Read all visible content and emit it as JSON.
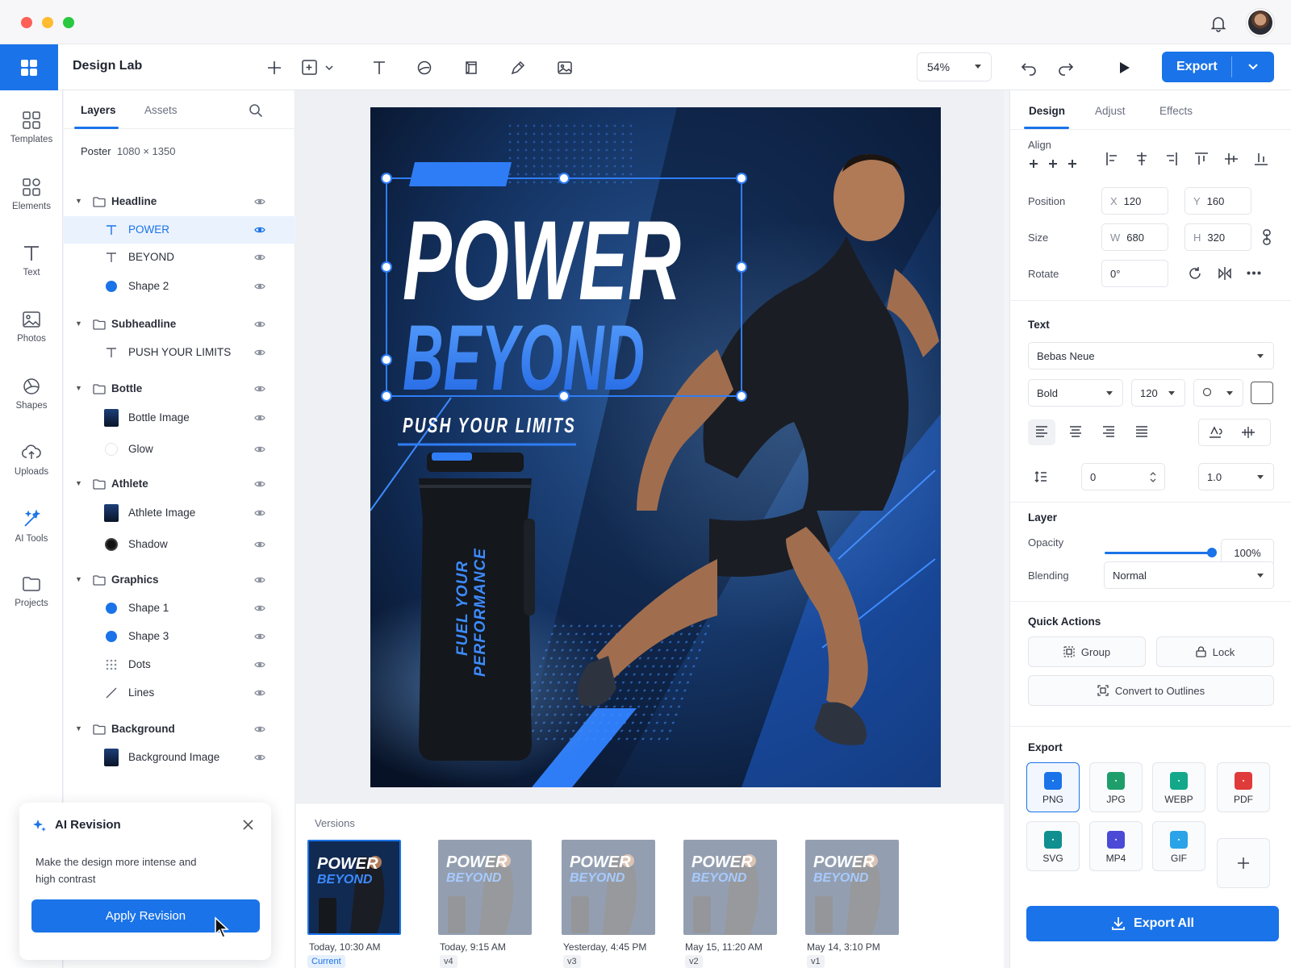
{
  "app": {
    "title": "Design Lab",
    "zoom": "54%",
    "export_label": "Export"
  },
  "rail": [
    {
      "label": "Templates",
      "icon": "templates-icon"
    },
    {
      "label": "Elements",
      "icon": "elements-icon"
    },
    {
      "label": "Text",
      "icon": "text-icon"
    },
    {
      "label": "Photos",
      "icon": "photos-icon"
    },
    {
      "label": "Shapes",
      "icon": "shapes-icon"
    },
    {
      "label": "Uploads",
      "icon": "uploads-icon"
    },
    {
      "label": "AI Tools",
      "icon": "ai-tools-icon"
    },
    {
      "label": "Projects",
      "icon": "projects-icon"
    }
  ],
  "layers_panel": {
    "tab_layers": "Layers",
    "tab_assets": "Assets",
    "doc_name": "Poster",
    "doc_size": "1080 × 1350",
    "rows": [
      {
        "name": "Headline",
        "kind": "group"
      },
      {
        "name": "POWER",
        "kind": "text",
        "selected": true
      },
      {
        "name": "BEYOND",
        "kind": "text"
      },
      {
        "name": "Shape 2",
        "kind": "shape"
      },
      {
        "name": "Subheadline",
        "kind": "group"
      },
      {
        "name": "PUSH YOUR LIMITS",
        "kind": "text"
      },
      {
        "name": "Bottle",
        "kind": "group"
      },
      {
        "name": "Bottle Image",
        "kind": "image"
      },
      {
        "name": "Glow",
        "kind": "glow"
      },
      {
        "name": "Athlete",
        "kind": "group"
      },
      {
        "name": "Athlete Image",
        "kind": "image"
      },
      {
        "name": "Shadow",
        "kind": "shadow"
      },
      {
        "name": "Graphics",
        "kind": "group"
      },
      {
        "name": "Shape 1",
        "kind": "shape"
      },
      {
        "name": "Shape 3",
        "kind": "shape"
      },
      {
        "name": "Dots",
        "kind": "dots"
      },
      {
        "name": "Lines",
        "kind": "lines"
      },
      {
        "name": "Background",
        "kind": "group"
      },
      {
        "name": "Background Image",
        "kind": "image"
      }
    ]
  },
  "ai_revision": {
    "title": "AI Revision",
    "prompt": "Make the design more intense and high contrast",
    "button": "Apply Revision"
  },
  "poster": {
    "line1": "POWER",
    "line2": "BEYOND",
    "subhead": "PUSH YOUR LIMITS",
    "bottle_text_1": "FUEL YOUR",
    "bottle_text_2": "PERFORMANCE"
  },
  "versions": {
    "title": "Versions",
    "items": [
      {
        "date": "Today, 10:30 AM",
        "tag": "Current"
      },
      {
        "date": "Today, 9:15 AM",
        "tag": "v4"
      },
      {
        "date": "Yesterday, 4:45 PM",
        "tag": "v3"
      },
      {
        "date": "May 15, 11:20 AM",
        "tag": "v2"
      },
      {
        "date": "May 14, 3:10 PM",
        "tag": "v1"
      }
    ]
  },
  "design_panel": {
    "tabs": [
      "Design",
      "Adjust",
      "Effects"
    ],
    "align_label": "Align",
    "position_label": "Position",
    "x_label": "X",
    "x": "120",
    "y_label": "Y",
    "y": "160",
    "size_label": "Size",
    "w_label": "W",
    "w": "680",
    "h_label": "H",
    "h": "320",
    "rotate_label": "Rotate",
    "rotate": "0°",
    "text_head": "Text",
    "font": "Bebas Neue",
    "weight": "Bold",
    "font_size": "120",
    "spacing": "0",
    "line_height": "1.0",
    "layer_head": "Layer",
    "opacity_label": "Opacity",
    "opacity": "100%",
    "opacity_value": 1.0,
    "blending_label": "Blending",
    "blending": "Normal",
    "quick_head": "Quick Actions",
    "group_btn": "Group",
    "lock_btn": "Lock",
    "outline_btn": "Convert to Outlines",
    "export_head": "Export",
    "formats": [
      {
        "label": "PNG",
        "color": "#1a73e8",
        "selected": true
      },
      {
        "label": "JPG",
        "color": "#1e9e6a"
      },
      {
        "label": "WEBP",
        "color": "#13a88a"
      },
      {
        "label": "PDF",
        "color": "#e03b3b"
      },
      {
        "label": "SVG",
        "color": "#0f8f8f"
      },
      {
        "label": "MP4",
        "color": "#4b4ad6"
      },
      {
        "label": "GIF",
        "color": "#2aa3e8"
      }
    ],
    "export_all": "Export All"
  },
  "colors": {
    "accent": "#1a73e8",
    "poster_bg": "#0d1e3c",
    "poster_blue": "#2f7df6"
  }
}
